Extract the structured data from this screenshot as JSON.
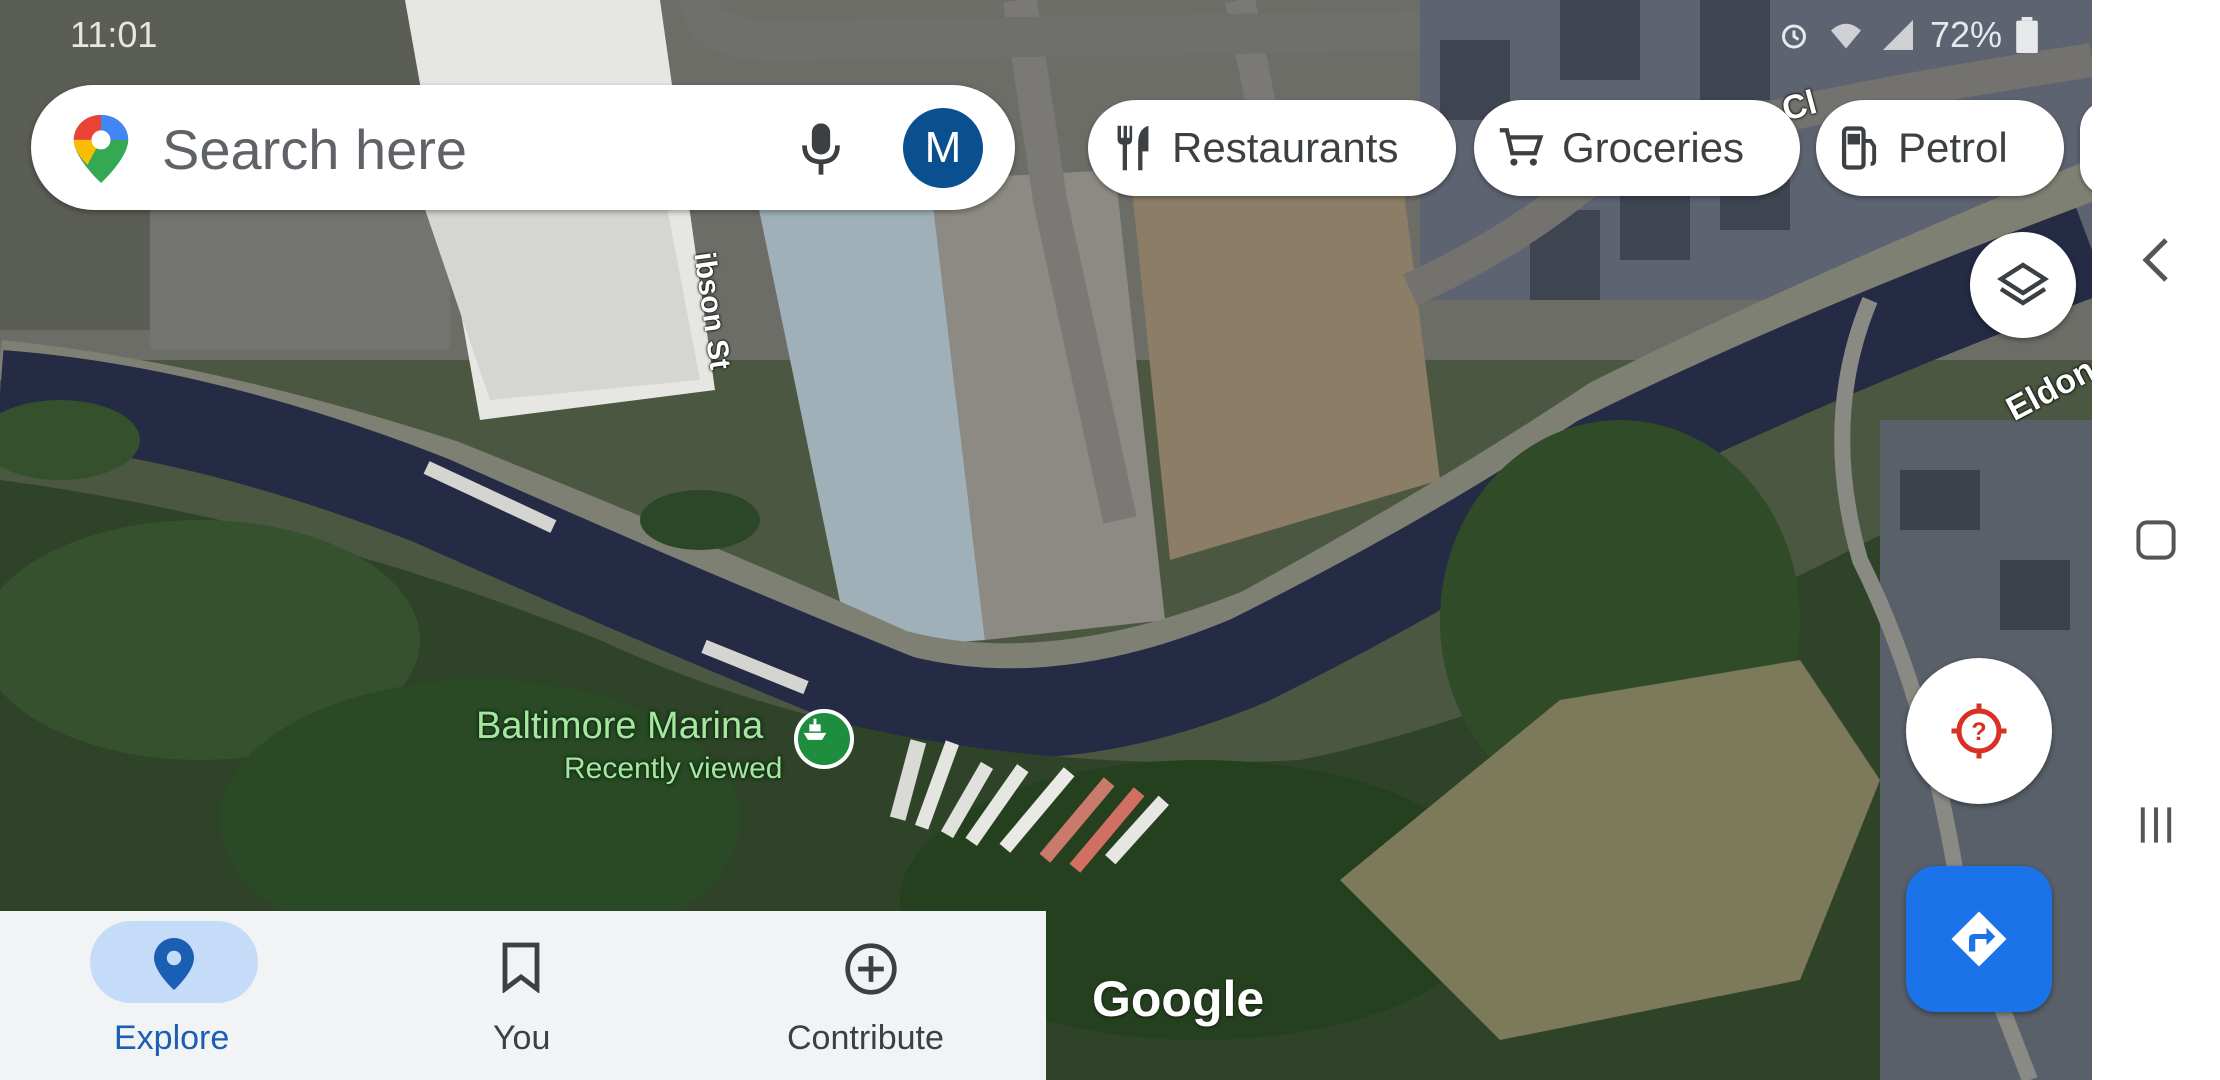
{
  "status_bar": {
    "time": "11:01",
    "battery": "72%"
  },
  "search": {
    "placeholder": "Search here",
    "avatar_letter": "M"
  },
  "chips": [
    {
      "label": "Restaurants",
      "icon": "restaurant-icon"
    },
    {
      "label": "Groceries",
      "icon": "cart-icon"
    },
    {
      "label": "Petrol",
      "icon": "gas-station-icon"
    }
  ],
  "map": {
    "place": {
      "name": "Baltimore Marina",
      "subtitle": "Recently viewed",
      "icon": "boat-icon"
    },
    "streets": {
      "gibson": "ibson St",
      "eldon": "Eldon",
      "close_fragment": "Cl"
    },
    "attribution": "Google"
  },
  "bottom_nav": {
    "items": [
      {
        "label": "Explore",
        "icon": "location-pin-icon",
        "active": true
      },
      {
        "label": "You",
        "icon": "bookmark-icon",
        "active": false
      },
      {
        "label": "Contribute",
        "icon": "add-circle-icon",
        "active": false
      }
    ]
  },
  "colors": {
    "accent": "#1a73e8",
    "active_nav_text": "#1a5fb4",
    "avatar_bg": "#0a4f8f",
    "place_label": "#a6e6a0",
    "location_icon": "#d93025"
  }
}
